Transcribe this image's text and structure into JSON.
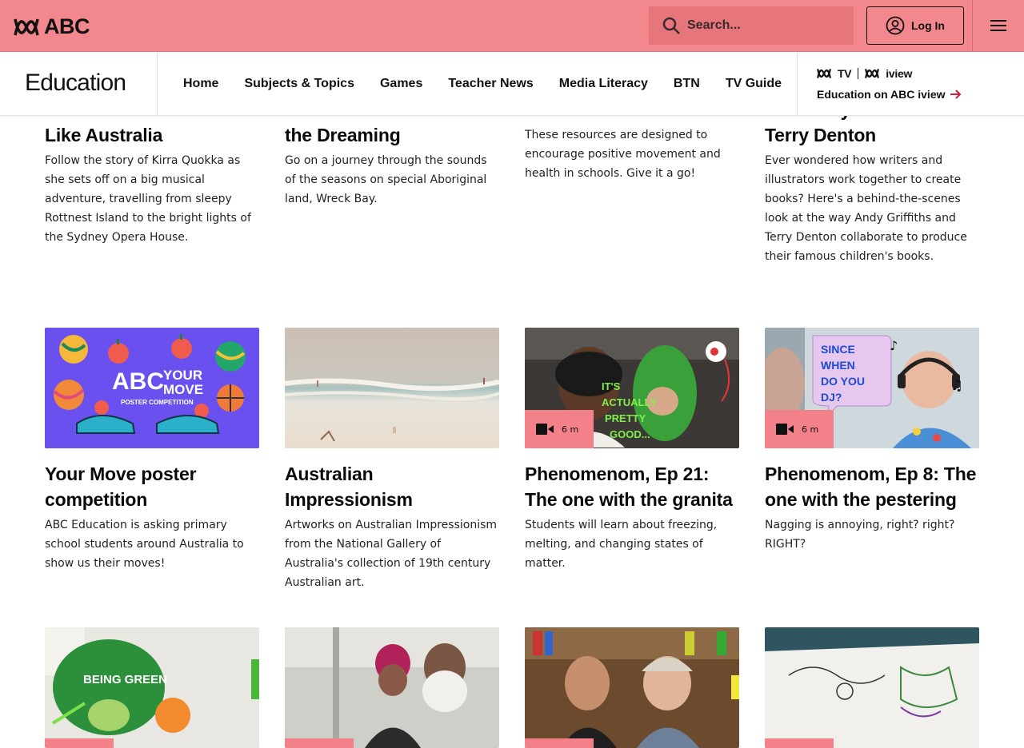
{
  "header": {
    "brand": "ABC",
    "search_placeholder": "Search...",
    "login_label": "Log In"
  },
  "section_nav": {
    "title": "Education",
    "links": [
      "Home",
      "Subjects & Topics",
      "Games",
      "Teacher News",
      "Media Literacy",
      "BTN",
      "TV Guide"
    ],
    "iview_link": "Education on ABC iview",
    "iview_marks": [
      "ABC TV",
      "ABC iview"
    ]
  },
  "colors": {
    "topbar": "#f2878d",
    "badge": "#f2818a"
  },
  "row1": [
    {
      "title": "Like Australia",
      "desc": "Follow the story of Kirra Quokka as she sets off on a big musical adventure, travelling from sleepy Rottnest Island to the bright lights of the Sydney Opera House."
    },
    {
      "title": "the Dreaming",
      "desc": "Go on a journey through the sounds of the seasons on special Aboriginal land, Wreck Bay."
    },
    {
      "title": "",
      "desc": "These resources are designed to encourage positive movement and health in schools. Give it a go!"
    },
    {
      "title": "with Andy Griffiths and Terry Denton",
      "desc": "Ever wondered how writers and illustrators work together to create books? Here's a behind-the-scenes look at the way Andy Griffiths and Terry Denton collaborate to produce their famous children's books."
    }
  ],
  "row2": [
    {
      "title": "Your Move poster competition",
      "desc": "ABC Education is asking primary school students around Australia to show us their moves!",
      "badge": ""
    },
    {
      "title": "Australian Impressionism",
      "desc": "Artworks on Australian Impressionism from the National Gallery of Australia's collection of 19th century Australian art.",
      "badge": ""
    },
    {
      "title": "Phenomenom, Ep 21: The one with the granita",
      "desc": "Students will learn about freezing, melting, and changing states of matter.",
      "badge": "6 m"
    },
    {
      "title": "Phenomenom, Ep 8: The one with the pestering",
      "desc": "Nagging is annoying, right? right? RIGHT?",
      "badge": "6 m"
    }
  ],
  "thumb_text": {
    "your_move_logo": "YOUR MOVE",
    "your_move_sub": "POSTER COMPETITION",
    "granita_caption": "IT'S ACTUALLY PRETTY GOOD...",
    "dj_bubble": "SINCE WHEN DO YOU DJ?",
    "being_green": "BEING GREEN"
  }
}
